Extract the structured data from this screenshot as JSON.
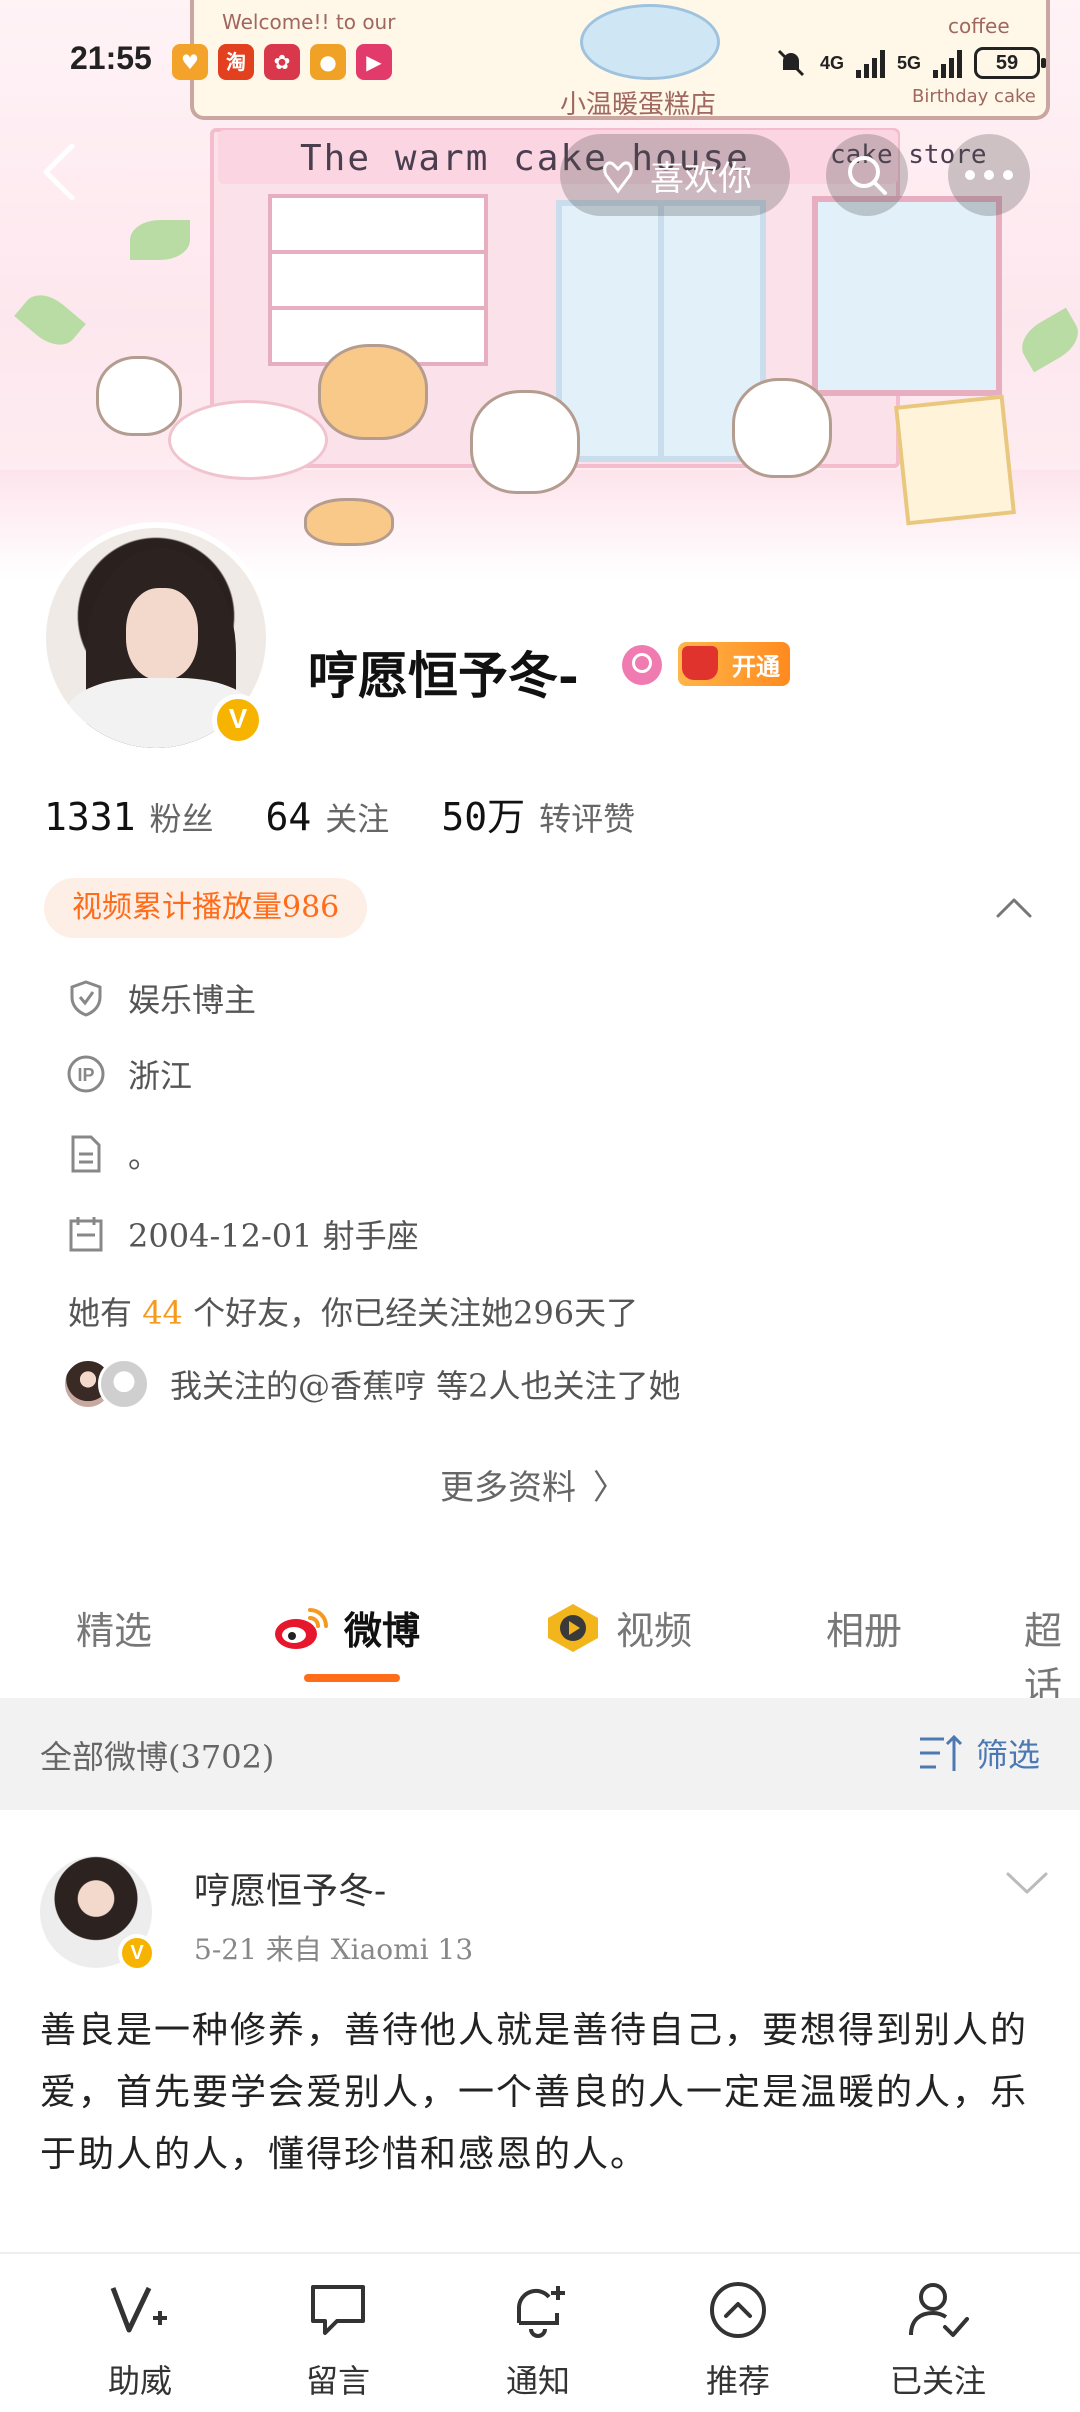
{
  "status_bar": {
    "time": "21:55",
    "network_1": "4G",
    "network_2": "5G",
    "battery": "59",
    "app_icons": [
      "pocket-icon",
      "taobao-icon",
      "game-icon",
      "weibo-icon",
      "video-icon"
    ]
  },
  "cover": {
    "sign_text": "The warm cake house",
    "store_text": "cake store",
    "board_text": "小温暖蛋糕店",
    "welcome_text": "Welcome!! to our",
    "coffee_text": "coffee",
    "birthday_text": "Birthday cake"
  },
  "top_nav": {
    "like_label": "喜欢你"
  },
  "profile": {
    "username": "哼愿恒予冬-",
    "vip_label": "开通",
    "verified_badge": "V"
  },
  "stats": [
    {
      "value": "1331",
      "label": "粉丝"
    },
    {
      "value": "64",
      "label": "关注"
    },
    {
      "value": "50万",
      "label": "转评赞"
    }
  ],
  "play_count": "视频累计播放量986",
  "info": {
    "category": "娱乐博主",
    "location": "浙江",
    "bio": "。",
    "birthday": "2004-12-01 射手座",
    "friends_prefix": "她有",
    "friends_count": "44",
    "friends_suffix": "个好友，你已经关注她296天了",
    "mutual_text": "我关注的@香蕉哼  等2人也关注了她",
    "more_label": "更多资料"
  },
  "tabs": [
    {
      "label": "精选"
    },
    {
      "label": "微博"
    },
    {
      "label": "视频"
    },
    {
      "label": "相册"
    },
    {
      "label": "超话"
    }
  ],
  "filter_bar": {
    "all_label": "全部微博(3702)",
    "filter_label": "筛选"
  },
  "post": {
    "author": "哼愿恒予冬-",
    "meta": "5-21  来自  Xiaomi 13",
    "body": "善良是一种修养，善待他人就是善待自己，要想得到别人的爱，首先要学会爱别人，一个善良的人一定是温暖的人，乐于助人的人，懂得珍惜和感恩的人。"
  },
  "bottom_bar": [
    {
      "label": "助威",
      "icon": "boost-icon"
    },
    {
      "label": "留言",
      "icon": "message-icon"
    },
    {
      "label": "通知",
      "icon": "bell-plus-icon"
    },
    {
      "label": "推荐",
      "icon": "recommend-icon"
    },
    {
      "label": "已关注",
      "icon": "followed-icon"
    }
  ],
  "colors": {
    "accent": "#ff6d1a",
    "link": "#4c79b4",
    "highlight": "#f59a1f",
    "verified": "#f6b400"
  }
}
